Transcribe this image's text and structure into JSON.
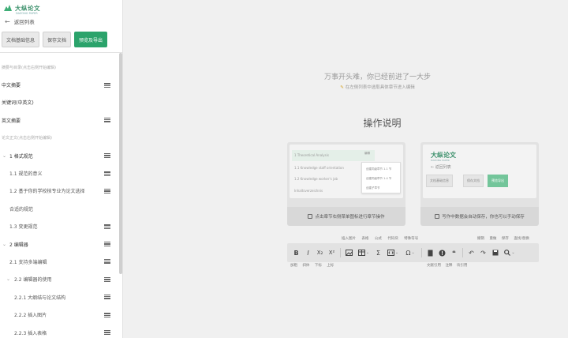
{
  "brand": {
    "name": "大纵论文",
    "sub": "DAZONG PAPER"
  },
  "sidebar": {
    "back_label": "返回列表",
    "buttons": {
      "basic_info": "文档基础信息",
      "save": "保存文档",
      "preview_export": "预览及导出"
    },
    "outline": [
      {
        "level": "group",
        "text": "摘要与目录(点击右侧开始编辑)"
      },
      {
        "level": "l0",
        "text": "中文摘要",
        "menu": true
      },
      {
        "level": "l0",
        "text": "关键词(中英文)",
        "menu": false
      },
      {
        "level": "l0",
        "text": "英文摘要",
        "menu": true
      },
      {
        "level": "group",
        "text": "论文正文(点击右侧开始编辑)"
      },
      {
        "level": "l1",
        "caret": "⌄",
        "text": "1 格式规范",
        "menu": true
      },
      {
        "level": "l2",
        "text": "1.1 规范的意义",
        "menu": true
      },
      {
        "level": "l2",
        "text": "1.2 基于你的学校核专业为论文选择",
        "menu": true
      },
      {
        "level": "l2",
        "text": "合适的规范",
        "menu": false,
        "cont": true
      },
      {
        "level": "l2",
        "text": "1.3 变更规范",
        "menu": true
      },
      {
        "level": "l1",
        "caret": "⌄",
        "text": "2 编辑器",
        "menu": true
      },
      {
        "level": "l2",
        "text": "2.1 支持多端编辑",
        "menu": true
      },
      {
        "level": "l2b",
        "caret": "⌄",
        "text": "2.2 编辑器的使用",
        "menu": true
      },
      {
        "level": "l3",
        "text": "2.2.1 大纲结与论文结构",
        "menu": true
      },
      {
        "level": "l3",
        "text": "2.2.2 插入图片",
        "menu": true
      },
      {
        "level": "l3",
        "text": "2.2.3 插入表格",
        "menu": true
      }
    ]
  },
  "main": {
    "headline": "万事开头难，你已经前进了一大步",
    "tip": "在左侧列表中选取具体章节进入编辑",
    "instructions_title": "操作说明",
    "card1": {
      "caption": "点击章节右侧菜单图标进行章节操作",
      "lines": [
        "1 Theoretical Analysis",
        "1.1 Knowledge staff orientation",
        "1.2 Knowledge worker's job",
        "Inhaltsverzeichnis"
      ],
      "tag": "编辑",
      "popup": [
        "创建同级章节 1.1 节",
        "创建同级章节 1.4 节",
        "创建子章节"
      ]
    },
    "card2": {
      "caption": "写作中数据会自动保存，你也可以手动保存",
      "back": "返回列表",
      "buttons": [
        "文档基础信息",
        "保存文档",
        "预览导出"
      ]
    },
    "toolbar": {
      "top_labels": [
        "插入图片",
        "表格",
        "公式",
        "代码块",
        "特殊符号"
      ],
      "top_labels_right": [
        "撤销",
        "重做",
        "保存",
        "查找/替换"
      ],
      "bottom_labels": [
        "加粗",
        "斜体",
        "下标",
        "上标"
      ],
      "bottom_labels_mid": [
        "文献引用",
        "注释",
        "块引用"
      ],
      "tools": [
        "B",
        "I",
        "X₂",
        "X²"
      ]
    }
  }
}
